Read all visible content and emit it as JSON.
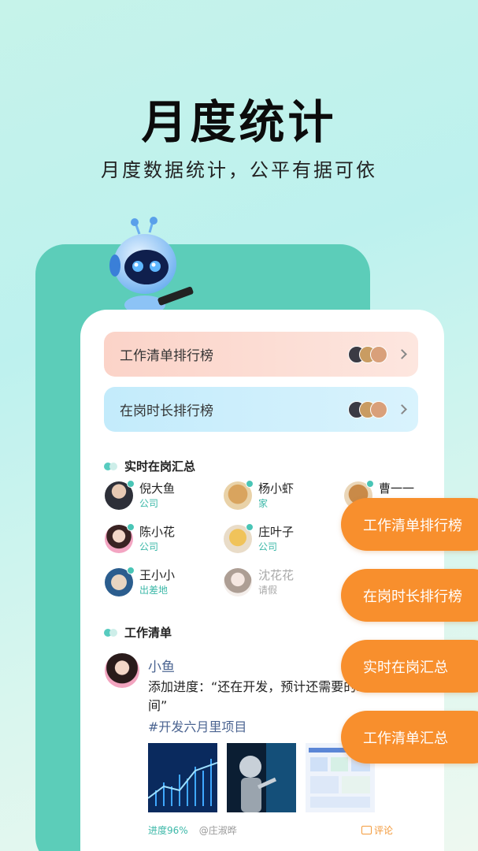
{
  "hero": {
    "title": "月度统计",
    "subtitle": "月度数据统计，公平有据可依"
  },
  "rankings": [
    {
      "label": "工作清单排行榜"
    },
    {
      "label": "在岗时长排行榜"
    }
  ],
  "realtime": {
    "title": "实时在岗汇总",
    "people": [
      {
        "name": "倪大鱼",
        "status": "公司"
      },
      {
        "name": "杨小虾",
        "status": "家"
      },
      {
        "name": "曹一一",
        "status": ""
      },
      {
        "name": "陈小花",
        "status": "公司"
      },
      {
        "name": "庄叶子",
        "status": "公司"
      },
      {
        "name": "王小小",
        "status": "出差地"
      },
      {
        "name": "沈花花",
        "status": "请假"
      }
    ]
  },
  "worklist": {
    "title": "工作清单",
    "post": {
      "author": "小鱼",
      "text": "添加进度：“还在开发，预计还需要的时间”",
      "tag": "#开发六月里项目",
      "progress": "进度96%",
      "mention": "@庄淑晔",
      "comment": "评论"
    }
  },
  "side_pills": [
    "工作清单排行榜",
    "在岗时长排行榜",
    "实时在岗汇总",
    "工作清单汇总"
  ],
  "colors": {
    "accent": "#f88f2d",
    "teal": "#5ccdb9",
    "link": "#4b6491"
  }
}
